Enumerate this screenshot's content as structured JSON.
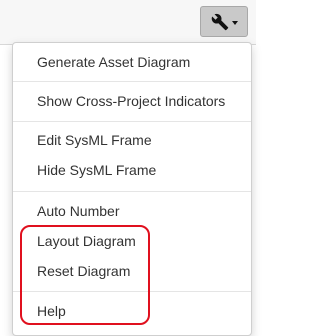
{
  "toolbar": {
    "tools_icon": "wrench-icon",
    "dropdown_icon": "caret-down-icon"
  },
  "menu": {
    "items": [
      {
        "label": "Generate Asset Diagram"
      },
      {
        "label": "Show Cross-Project Indicators"
      },
      {
        "label": "Edit SysML Frame"
      },
      {
        "label": "Hide SysML Frame"
      },
      {
        "label": "Auto Number"
      },
      {
        "label": "Layout Diagram"
      },
      {
        "label": "Reset Diagram"
      },
      {
        "label": "Help"
      }
    ]
  },
  "colors": {
    "highlight": "#e0101e",
    "button_bg": "#c9c9c9",
    "menu_text": "#333333"
  }
}
